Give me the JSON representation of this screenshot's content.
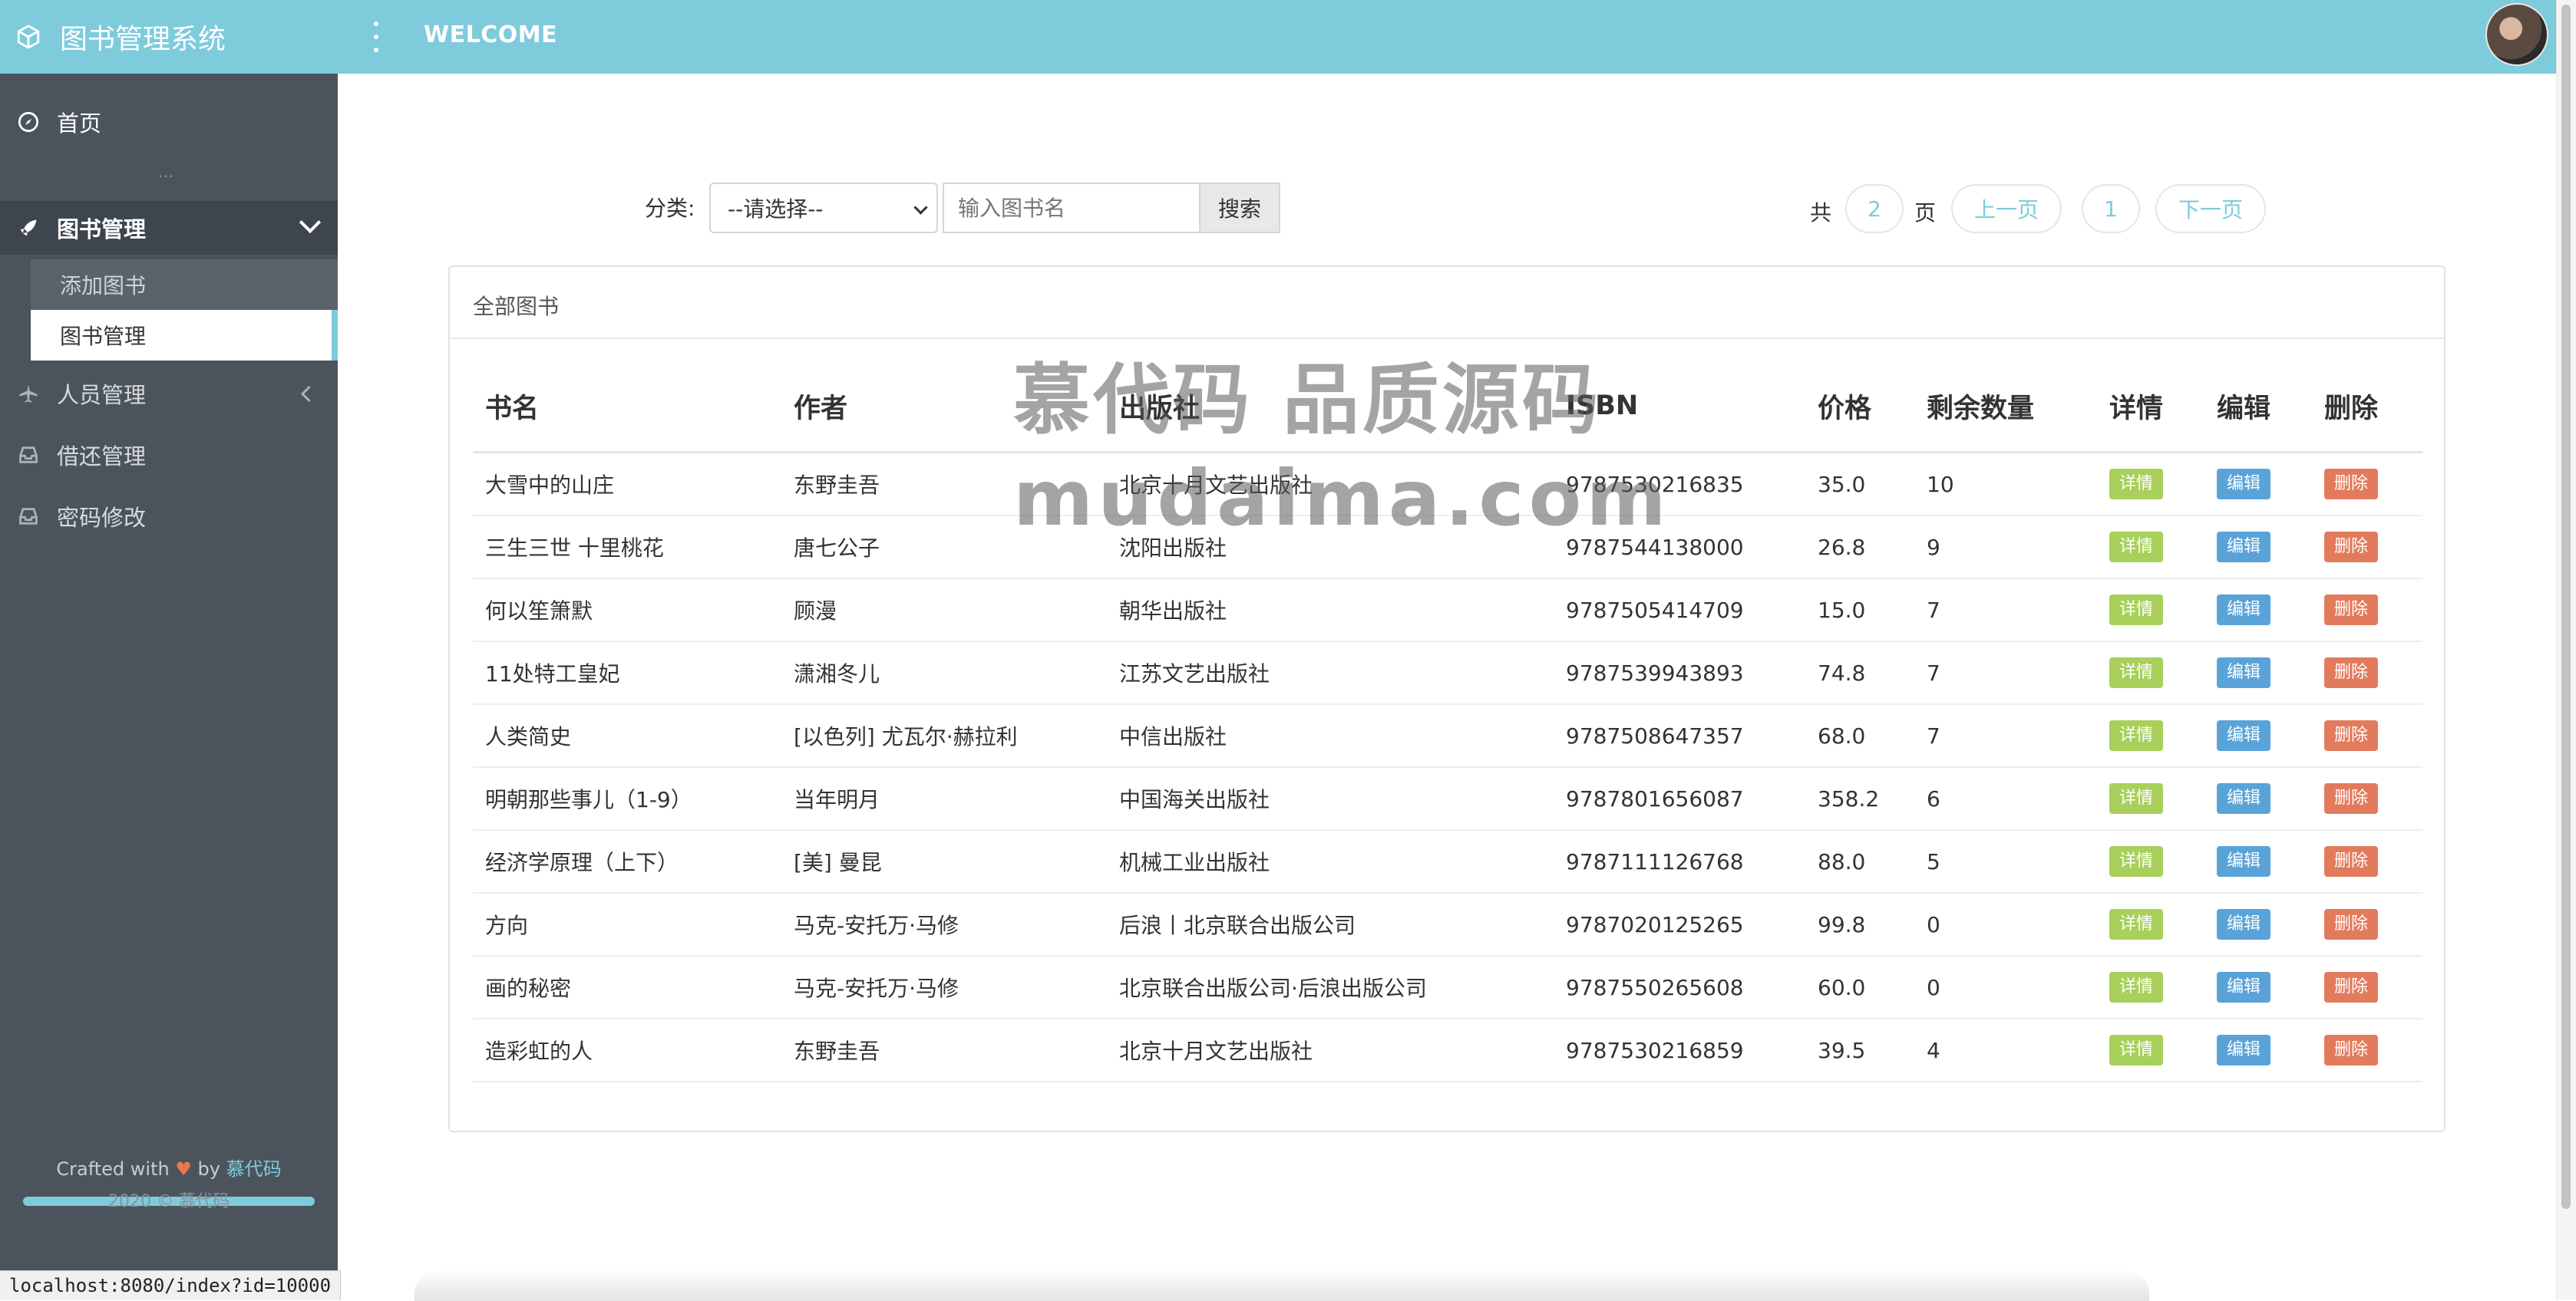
{
  "app": {
    "title": "图书管理系统",
    "welcome": "WELCOME"
  },
  "sidebar": {
    "home": "首页",
    "dots": "…",
    "book_mgmt": "图书管理",
    "book_sub": [
      "添加图书",
      "图书管理"
    ],
    "staff": "人员管理",
    "borrow": "借还管理",
    "password": "密码修改",
    "footer_prefix": "Crafted with",
    "footer_by": "by",
    "footer_author": "慕代码",
    "footer_line2": "2020 © 慕代码"
  },
  "status_url": "localhost:8080/index?id=10000",
  "toolbar": {
    "filter_label": "分类:",
    "select_value": "--请选择--",
    "search_placeholder": "输入图书名",
    "search_button": "搜索"
  },
  "pager": {
    "total_prefix": "共",
    "total_pages": "2",
    "total_suffix": "页",
    "prev": "上一页",
    "current": "1",
    "next": "下一页"
  },
  "panel": {
    "title": "全部图书"
  },
  "table": {
    "headers": [
      "书名",
      "作者",
      "出版社",
      "ISBN",
      "价格",
      "剩余数量",
      "详情",
      "编辑",
      "删除"
    ],
    "btn_detail": "详情",
    "btn_edit": "编辑",
    "btn_delete": "删除",
    "rows": [
      [
        "大雪中的山庄",
        "东野圭吾",
        "北京十月文艺出版社",
        "9787530216835",
        "35.0",
        "10"
      ],
      [
        "三生三世 十里桃花",
        "唐七公子",
        "沈阳出版社",
        "9787544138000",
        "26.8",
        "9"
      ],
      [
        "何以笙箫默",
        "顾漫",
        "朝华出版社",
        "9787505414709",
        "15.0",
        "7"
      ],
      [
        "11处特工皇妃",
        "潇湘冬儿",
        "江苏文艺出版社",
        "9787539943893",
        "74.8",
        "7"
      ],
      [
        "人类简史",
        "[以色列] 尤瓦尔·赫拉利",
        "中信出版社",
        "9787508647357",
        "68.0",
        "7"
      ],
      [
        "明朝那些事儿（1-9）",
        "当年明月",
        "中国海关出版社",
        "9787801656087",
        "358.2",
        "6"
      ],
      [
        "经济学原理（上下）",
        "[美] 曼昆",
        "机械工业出版社",
        "9787111126768",
        "88.0",
        "5"
      ],
      [
        "方向",
        "马克-安托万·马修",
        "后浪丨北京联合出版公司",
        "9787020125265",
        "99.8",
        "0"
      ],
      [
        "画的秘密",
        "马克-安托万·马修",
        "北京联合出版公司·后浪出版公司",
        "9787550265608",
        "60.0",
        "0"
      ],
      [
        "造彩虹的人",
        "东野圭吾",
        "北京十月文艺出版社",
        "9787530216859",
        "39.5",
        "4"
      ]
    ]
  },
  "watermark": {
    "line1": "慕代码 品质源码",
    "line2": "mudaima.com"
  },
  "colors": {
    "accent": "#7ecbdc",
    "sidebar": "#4b545c",
    "detail": "#a8d05a",
    "edit": "#5aa3d8",
    "delete": "#e27b5c"
  }
}
